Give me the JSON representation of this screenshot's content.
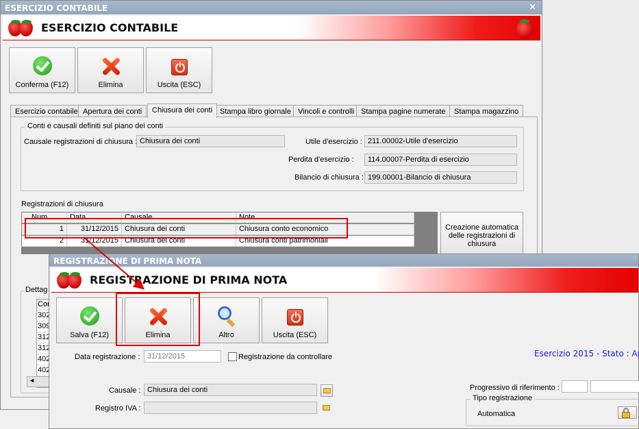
{
  "win1": {
    "titlebar": "ESERCIZIO CONTABILE",
    "close": "×",
    "banner_title": "ESERCIZIO CONTABILE",
    "toolbar": {
      "confirm": "Conferma (F12)",
      "delete": "Elimina",
      "exit": "Uscita (ESC)"
    },
    "tabs": [
      "Esercizio contabile",
      "Apertura dei conti",
      "Chiusura dei conti",
      "Stampa libro giornale",
      "Vincoli e controlli",
      "Stampa pagine numerate",
      "Stampa magazzino"
    ],
    "group_title": "Conti e causali definiti sul piano dei conti",
    "causale_label": "Causale registrazioni di chiusura :",
    "causale_value": "Chiusura dei conti",
    "utile_label": "Utile d'esercizio :",
    "utile_value": "211.00002-Utile d'esercizio",
    "perdita_label": "Perdita d'esercizio :",
    "perdita_value": "114.00007-Perdita di esercizio",
    "bilancio_label": "Bilancio di chiusura :",
    "bilancio_value": "199.00001-Bilancio di chiusura",
    "registrazioni_title": "Registrazioni di chiusura",
    "grid": {
      "headers": [
        "Num.",
        "Data",
        "Causale",
        "Note"
      ],
      "rows": [
        {
          "num": "1",
          "data": "31/12/2015",
          "causale": "Chiusura dei conti",
          "note": "Chiusura conto economico"
        },
        {
          "num": "2",
          "data": "31/12/2015",
          "causale": "Chiusura dei conti",
          "note": "Chiusura conti patrimoniali"
        }
      ]
    },
    "auto_button": "Creazione automatica delle registrazioni di chiusura",
    "dettaglio_title": "Dettag",
    "dettaglio_header": "Con",
    "dettaglio_rows": [
      "302",
      "309",
      "312",
      "312",
      "402",
      "402"
    ],
    "scroll_left": "◄"
  },
  "win2": {
    "titlebar": "REGISTRAZIONE DI PRIMA NOTA",
    "banner_title": "REGISTRAZIONE DI PRIMA NOTA",
    "toolbar": {
      "save": "Salva (F12)",
      "delete": "Elimina",
      "other": "Altro",
      "exit": "Uscita (ESC)"
    },
    "data_label": "Data registrazione :",
    "data_value": "31/12/2015",
    "controllare_label": "Registrazione da controllare",
    "status": "Esercizio 2015 - Stato : Ap",
    "causale_label": "Causale :",
    "causale_value": "Chiusura dei conti",
    "registro_label": "Registro IVA :",
    "registro_value": "",
    "progressivo_label": "Progressivo di riferimento :",
    "tipo_title": "Tipo registrazione",
    "tipo_value": "Automatica"
  },
  "colors": {
    "highlight": "#e10000",
    "status_text": "#1a1ad0"
  }
}
